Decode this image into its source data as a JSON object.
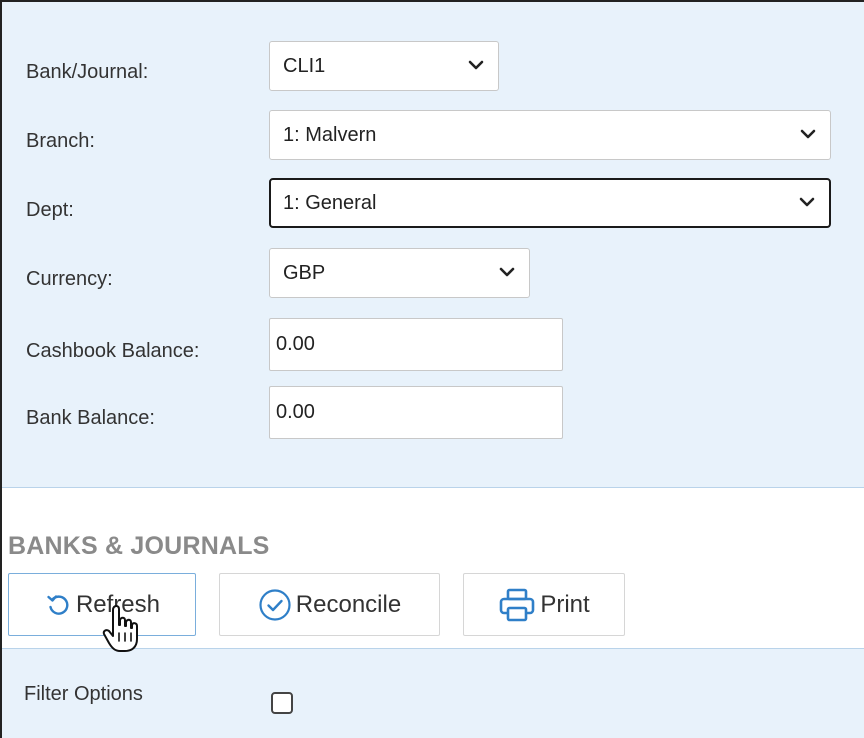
{
  "form": {
    "bank_journal": {
      "label": "Bank/Journal:",
      "value": "CLI1"
    },
    "branch": {
      "label": "Branch:",
      "value": "1: Malvern"
    },
    "dept": {
      "label": "Dept:",
      "value": "1: General"
    },
    "currency": {
      "label": "Currency:",
      "value": "GBP"
    },
    "cashbook_balance": {
      "label": "Cashbook Balance:",
      "value": "0.00"
    },
    "bank_balance": {
      "label": "Bank Balance:",
      "value": "0.00"
    }
  },
  "section": {
    "title": "BANKS & JOURNALS"
  },
  "toolbar": {
    "refresh_label": "Refresh",
    "reconcile_label": "Reconcile",
    "print_label": "Print"
  },
  "filter": {
    "label": "Filter Options",
    "checked": false
  },
  "colors": {
    "panel_bg": "#e8f2fb",
    "accent": "#2f7fc8",
    "title_gray": "#8a8a8a"
  },
  "icons": [
    "chevron-down-icon",
    "refresh-icon",
    "check-circle-icon",
    "printer-icon",
    "hand-cursor-icon"
  ]
}
